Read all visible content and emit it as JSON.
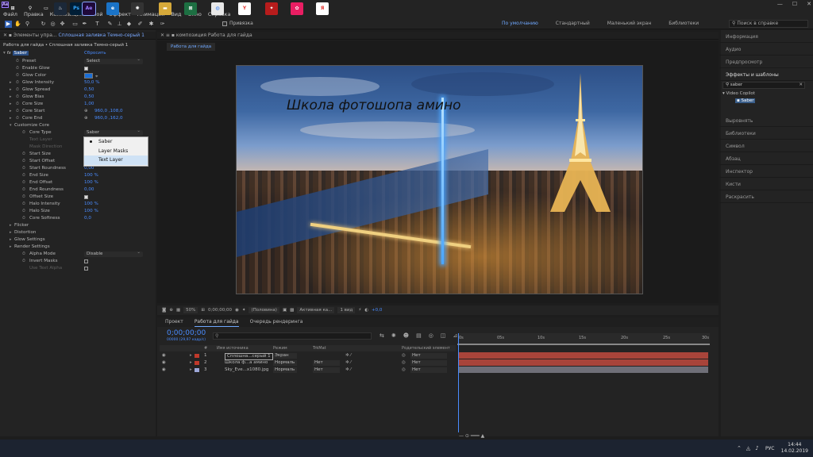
{
  "app": {
    "logo": "Ae"
  },
  "window_buttons": [
    "—",
    "☐",
    "✕"
  ],
  "menu": [
    "Файл",
    "Правка",
    "Композиция",
    "Слой",
    "Эффект",
    "Анимация",
    "Вид",
    "Окно",
    "Справка"
  ],
  "toolbar": {
    "snap_label": "Привязка",
    "workspaces": [
      "По умолчанию",
      "Стандартный",
      "Маленький экран",
      "Библиотеки"
    ],
    "search_placeholder": "Поиск в справке"
  },
  "effects_panel": {
    "tab_label": "Элементы упра...",
    "tab_target": "Сплошная заливка Темно-серый 1",
    "breadcrumb": "Работа для гайда • Сплошная заливка Темно-серый 1",
    "fx_name": "Saber",
    "reset_label": "Сбросить",
    "rows": [
      {
        "name": "Preset",
        "type": "dropdown",
        "value": "Select"
      },
      {
        "name": "Enable Glow",
        "type": "check",
        "value": "on"
      },
      {
        "name": "Glow Color",
        "type": "color",
        "value": "#1a6fd8"
      },
      {
        "name": "Glow Intensity",
        "value": "50,0 %"
      },
      {
        "name": "Glow Spread",
        "value": "0,50"
      },
      {
        "name": "Glow Bias",
        "value": "0,50"
      },
      {
        "name": "Core Size",
        "value": "1,00"
      },
      {
        "name": "Core Start",
        "value": "960,0 ,108,0"
      },
      {
        "name": "Core End",
        "value": "960,0 ,162,0"
      },
      {
        "name": "Customize Core",
        "value": ""
      },
      {
        "name": "Core Type",
        "type": "dropdown",
        "value": "Saber"
      },
      {
        "name": "Text Layer",
        "value": "",
        "dim": true
      },
      {
        "name": "Mask Direction",
        "value": "",
        "dim": true
      },
      {
        "name": "Start Size",
        "value": "100 %"
      },
      {
        "name": "Start Offset",
        "value": "0,0 %"
      },
      {
        "name": "Start Roundness",
        "value": "0,00"
      },
      {
        "name": "End Size",
        "value": "100 %"
      },
      {
        "name": "End Offset",
        "value": "100 %"
      },
      {
        "name": "End Roundness",
        "value": "0,00"
      },
      {
        "name": "Offset Size",
        "type": "check",
        "value": "on"
      },
      {
        "name": "Halo Intensity",
        "value": "100 %"
      },
      {
        "name": "Halo Size",
        "value": "100 %"
      },
      {
        "name": "Core Softness",
        "value": "0,0"
      },
      {
        "name": "Flicker",
        "value": ""
      },
      {
        "name": "Distortion",
        "value": ""
      },
      {
        "name": "Glow Settings",
        "value": ""
      },
      {
        "name": "Render Settings",
        "value": ""
      },
      {
        "name": "Alpha Mode",
        "type": "dropdown",
        "value": "Disable"
      },
      {
        "name": "Invert Masks",
        "type": "check",
        "value": "off"
      },
      {
        "name": "Use Text Alpha",
        "type": "check",
        "value": "off",
        "dim": true
      }
    ],
    "core_type_options": [
      "Saber",
      "Layer Masks",
      "Text Layer"
    ],
    "core_type_selected": "Saber",
    "core_type_highlight": "Text Layer"
  },
  "viewer": {
    "tab_label": "композиция Работа для гайда",
    "sub_tab": "Работа для гайда",
    "overlay_text": "Школа фотошопа амино",
    "zoom": "50%",
    "timecode": "0;00;00;00",
    "resolution": "(Половина)",
    "camera": "Активная ка...",
    "views": "1 вид",
    "exposure": "+0,0"
  },
  "timeline": {
    "tabs": [
      "Проект",
      "Работа для гайда",
      "Очередь рендеринга"
    ],
    "active_tab": "Работа для гайда",
    "timecode": "0;00;00;00",
    "timecode_sub": "00000 (29,97 кадр/с)",
    "columns": [
      "#",
      "Имя источника",
      "Режим",
      "TrkMat",
      "Родительский элемент"
    ],
    "layers": [
      {
        "num": "1",
        "name": "Сплошна...серый 1",
        "mode": "Экран",
        "trkmat": "",
        "parent": "Нет",
        "color": "#c0392b"
      },
      {
        "num": "2",
        "name": "Школа ф...а амино",
        "mode": "Нормаль",
        "trkmat": "Нет",
        "parent": "Нет",
        "color": "#c0392b"
      },
      {
        "num": "3",
        "name": "Sky_Eve...x1080.jpg",
        "mode": "Нормаль",
        "trkmat": "Нет",
        "parent": "Нет",
        "color": "#9da7d8"
      }
    ],
    "ruler": [
      "0s",
      "05s",
      "10s",
      "15s",
      "20s",
      "25s",
      "30s"
    ]
  },
  "right_panel": {
    "items": [
      "Информация",
      "Аудио",
      "Предпросмотр",
      "Эффекты и шаблоны",
      "Выровнять",
      "Библиотеки",
      "Символ",
      "Абзац",
      "Инспектор",
      "Кисти",
      "Раскрасить"
    ],
    "search_value": "saber",
    "tree_folder": "Video Copilot",
    "tree_item": "Saber"
  },
  "taskbar": {
    "apps": [
      "start",
      "search",
      "task-view",
      "steam",
      "Ps",
      "Ae",
      "ie",
      "winamp",
      "folder",
      "excel",
      "chrome",
      "yandex",
      "dreamspark",
      "app-pink",
      "yandex-browser"
    ],
    "lang": "РУС",
    "time": "14:44",
    "date": "14.02.2019"
  }
}
